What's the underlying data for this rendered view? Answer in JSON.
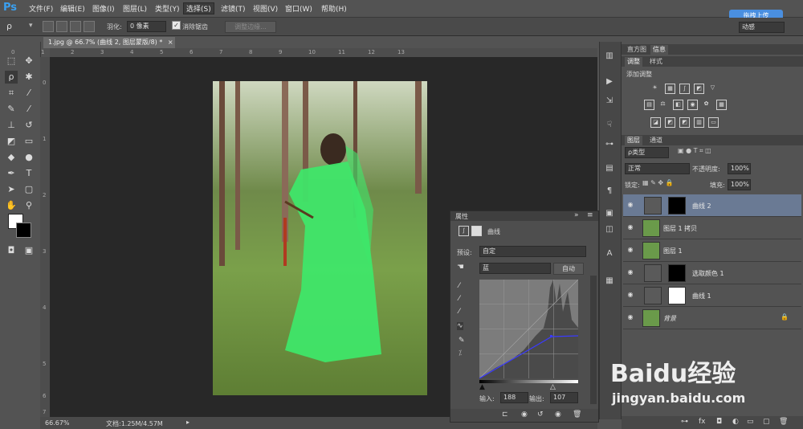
{
  "app": {
    "logo": "Ps"
  },
  "menu": [
    "文件(F)",
    "编辑(E)",
    "图像(I)",
    "图层(L)",
    "类型(Y)",
    "选择(S)",
    "滤镜(T)",
    "视图(V)",
    "窗口(W)",
    "帮助(H)"
  ],
  "options": {
    "feather_label": "羽化:",
    "feather_value": "0 像素",
    "antialias_label": "消除锯齿",
    "refine_btn": "调整边缘...",
    "upload_btn": "拖拽上传",
    "workspace": "动感"
  },
  "document": {
    "tab_title": "1.jpg @ 66.7% (曲线 2, 图层蒙版/8) *",
    "zoom": "66.67%",
    "doc_info": "文档:1.25M/4.57M"
  },
  "ruler_h": [
    "0",
    "1",
    "2",
    "3",
    "4",
    "5",
    "6",
    "7",
    "8",
    "9",
    "10",
    "11",
    "12",
    "13"
  ],
  "ruler_v": [
    "0",
    "1",
    "2",
    "3",
    "4",
    "5",
    "6",
    "7"
  ],
  "right_tabs": {
    "top": [
      "直方图",
      "信息"
    ],
    "adjust": [
      "调整",
      "样式"
    ],
    "layers": [
      "图层",
      "通道"
    ]
  },
  "adjustments": {
    "title": "添加调整"
  },
  "layers_panel": {
    "filter": "ρ类型",
    "blend_mode": "正常",
    "opacity_label": "不透明度:",
    "opacity": "100%",
    "lock_label": "锁定:",
    "fill_label": "填充:",
    "fill": "100%",
    "layers": [
      {
        "name": "曲线 2"
      },
      {
        "name": "图层 1 拷贝"
      },
      {
        "name": "图层 1"
      },
      {
        "name": "选取颜色 1"
      },
      {
        "name": "曲线 1"
      },
      {
        "name": "背景"
      }
    ]
  },
  "properties": {
    "tab": "属性",
    "type": "曲线",
    "preset_label": "预设:",
    "preset": "自定",
    "channel": "蓝",
    "auto_btn": "自动",
    "input_label": "输入:",
    "input": "188",
    "output_label": "输出:",
    "output": "107"
  },
  "watermark": {
    "brand": "Baidu经验",
    "url": "jingyan.baidu.com"
  },
  "colors": {
    "accent": "#4a8fe0",
    "selected_layer": "#6a7a94",
    "curve_line": "#3a3aff"
  }
}
